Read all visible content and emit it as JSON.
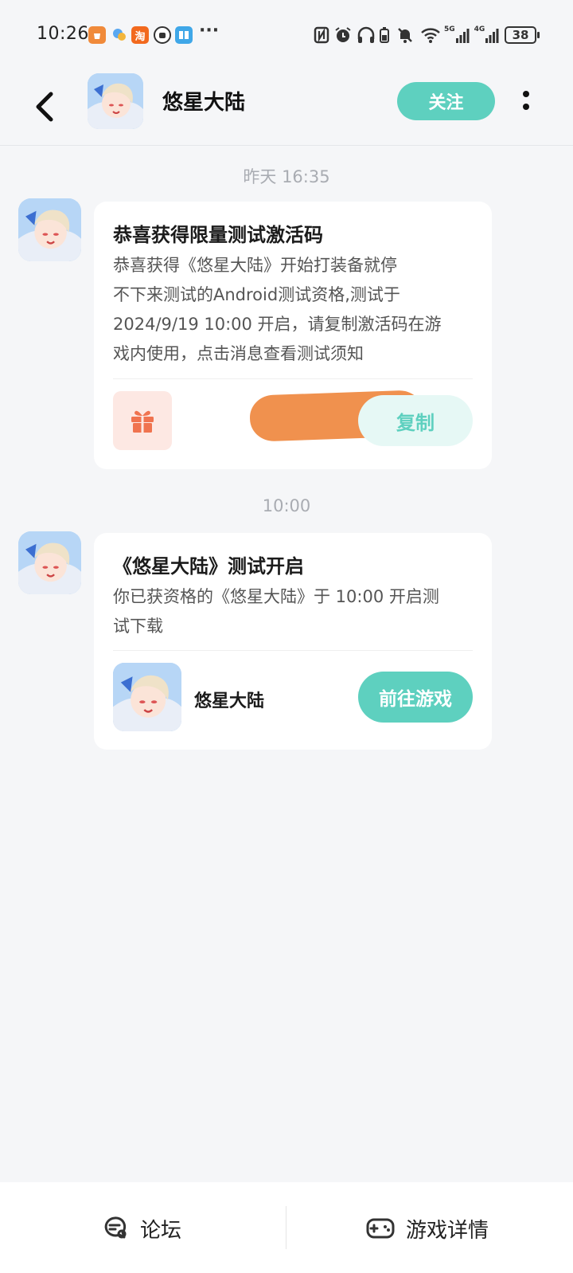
{
  "status_bar": {
    "time": "10:26",
    "app_icons": [
      "shopping-bag-icon",
      "app-icon",
      "taobao-icon",
      "hand-icon",
      "book-icon"
    ],
    "taobao_label": "淘",
    "more": "···",
    "signal_5g": "5G",
    "signal_4g": "4G",
    "battery": "38"
  },
  "header": {
    "title": "悠星大陆",
    "follow_label": "关注"
  },
  "messages": [
    {
      "time": "昨天  16:35",
      "title": "恭喜获得限量测试激活码",
      "body_lines": [
        "恭喜获得《悠星大陆》开始打装备就停",
        "不下来测试的Android测试资格,测试于",
        "2024/9/19 10:00 开启，请复制激活码在游",
        "戏内使用，点击消息查看测试须知"
      ],
      "action_label": "复制"
    },
    {
      "time": "10:00",
      "title": "《悠星大陆》测试开启",
      "body_lines": [
        "你已获资格的《悠星大陆》于 10:00 开启测",
        "试下载"
      ],
      "game_name": "悠星大陆",
      "action_label": "前往游戏"
    }
  ],
  "bottom_nav": {
    "forum_label": "论坛",
    "game_detail_label": "游戏详情"
  },
  "colors": {
    "accent": "#5ed0bf",
    "background": "#f5f6f8",
    "redaction": "#f0914e"
  }
}
